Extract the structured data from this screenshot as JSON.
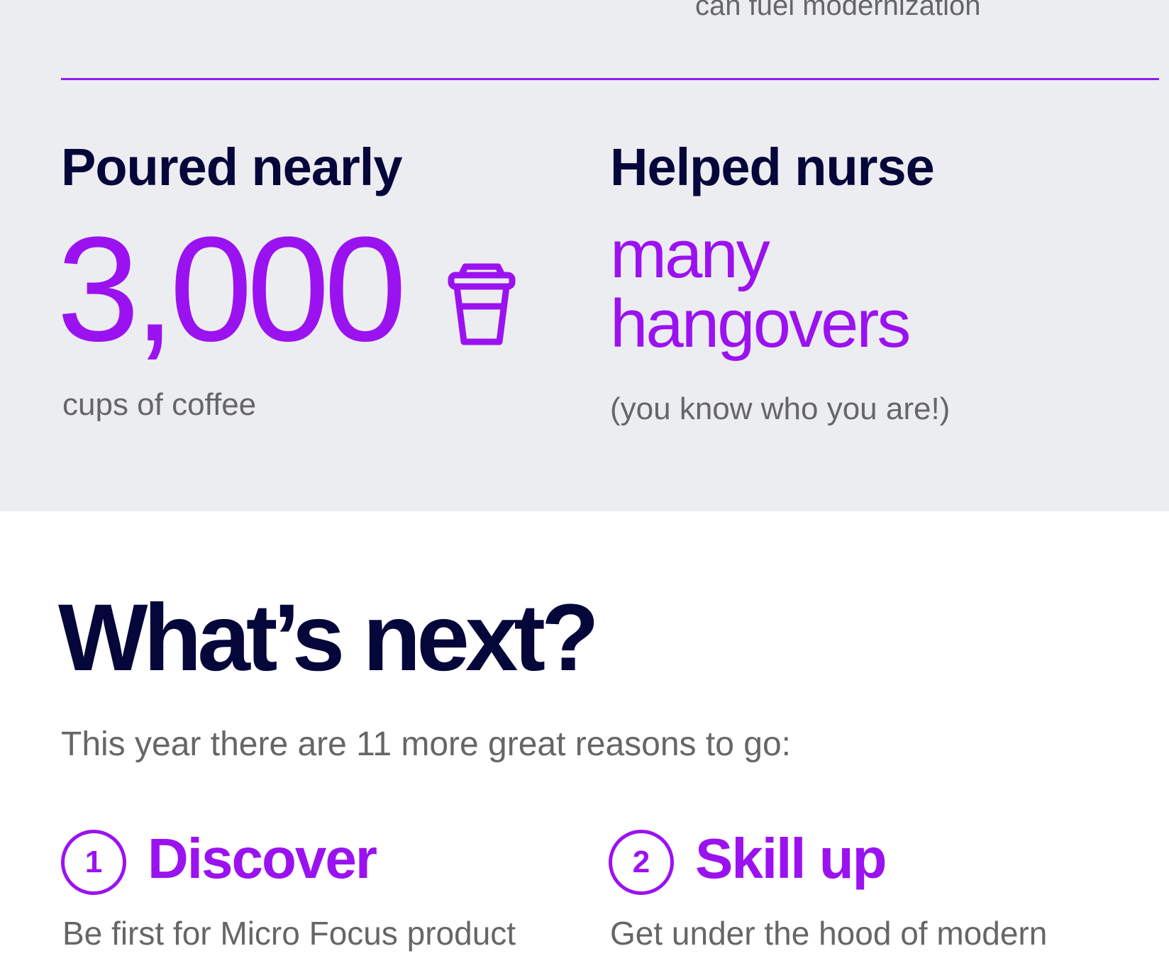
{
  "top_partial_text": "can fuel modernization",
  "stats": [
    {
      "heading": "Poured nearly",
      "value": "3,000",
      "icon": "coffee-cup-icon",
      "caption": "cups of coffee"
    },
    {
      "heading": "Helped nurse",
      "value_lines": [
        "many",
        "hangovers"
      ],
      "caption": "(you know who you are!)"
    }
  ],
  "whats_next": {
    "title": "What’s next?",
    "intro": "This year there are 11 more great reasons to go:",
    "reasons": [
      {
        "number": "1",
        "title": "Discover",
        "description": "Be first for Micro Focus product"
      },
      {
        "number": "2",
        "title": "Skill up",
        "description": "Get under the hood of modern"
      }
    ]
  },
  "colors": {
    "accent": "#9b12f0",
    "heading": "#05063a",
    "body_text": "#666666",
    "section_background": "#ecedf0",
    "page_background": "#ffffff"
  }
}
